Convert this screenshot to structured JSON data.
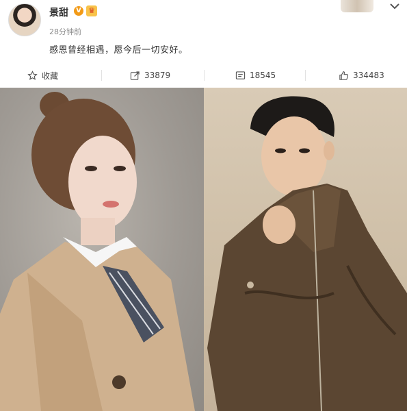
{
  "post": {
    "username": "景甜",
    "verified_badge": "V",
    "timestamp": "28分钟前",
    "text": "感恩曾经相遇，愿今后一切安好。"
  },
  "actions": {
    "favorite_label": "收藏",
    "repost_count": "33879",
    "comment_count": "18545",
    "like_count": "334483"
  },
  "icons": [
    "avatar",
    "verified-icon",
    "crown-icon",
    "more-icon",
    "star-icon",
    "repost-icon",
    "comment-icon",
    "like-icon"
  ],
  "colors": {
    "badge_orange": "#f29a17",
    "text_primary": "#333333",
    "text_secondary": "#8a8a8a"
  }
}
